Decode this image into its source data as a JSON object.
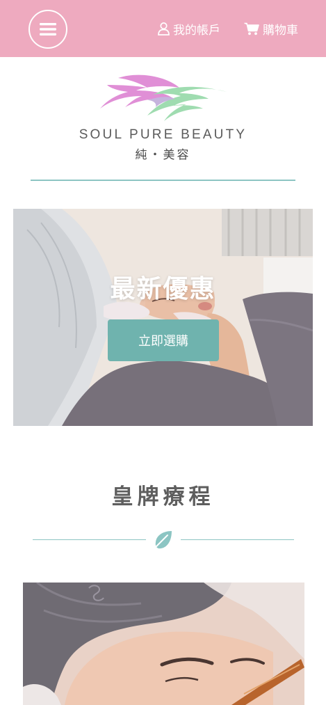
{
  "header": {
    "menu_icon": "hamburger-menu-icon",
    "account_label": "我的帳戶",
    "account_icon": "user-icon",
    "cart_label": "購物車",
    "cart_icon": "shopping-cart-icon",
    "background_color": "#eeaabf"
  },
  "logo": {
    "brand_name": "SOUL PURE BEAUTY",
    "brand_sub": "純・美容",
    "mark_colors": [
      "#e08fd6",
      "#9fdcb0"
    ]
  },
  "hero": {
    "title": "最新優惠",
    "button_label": "立即選購",
    "accent_color": "#6fb3ae"
  },
  "section": {
    "title": "皇牌療程",
    "divider_icon": "leaf-icon",
    "accent_color": "#8cc5c3"
  }
}
